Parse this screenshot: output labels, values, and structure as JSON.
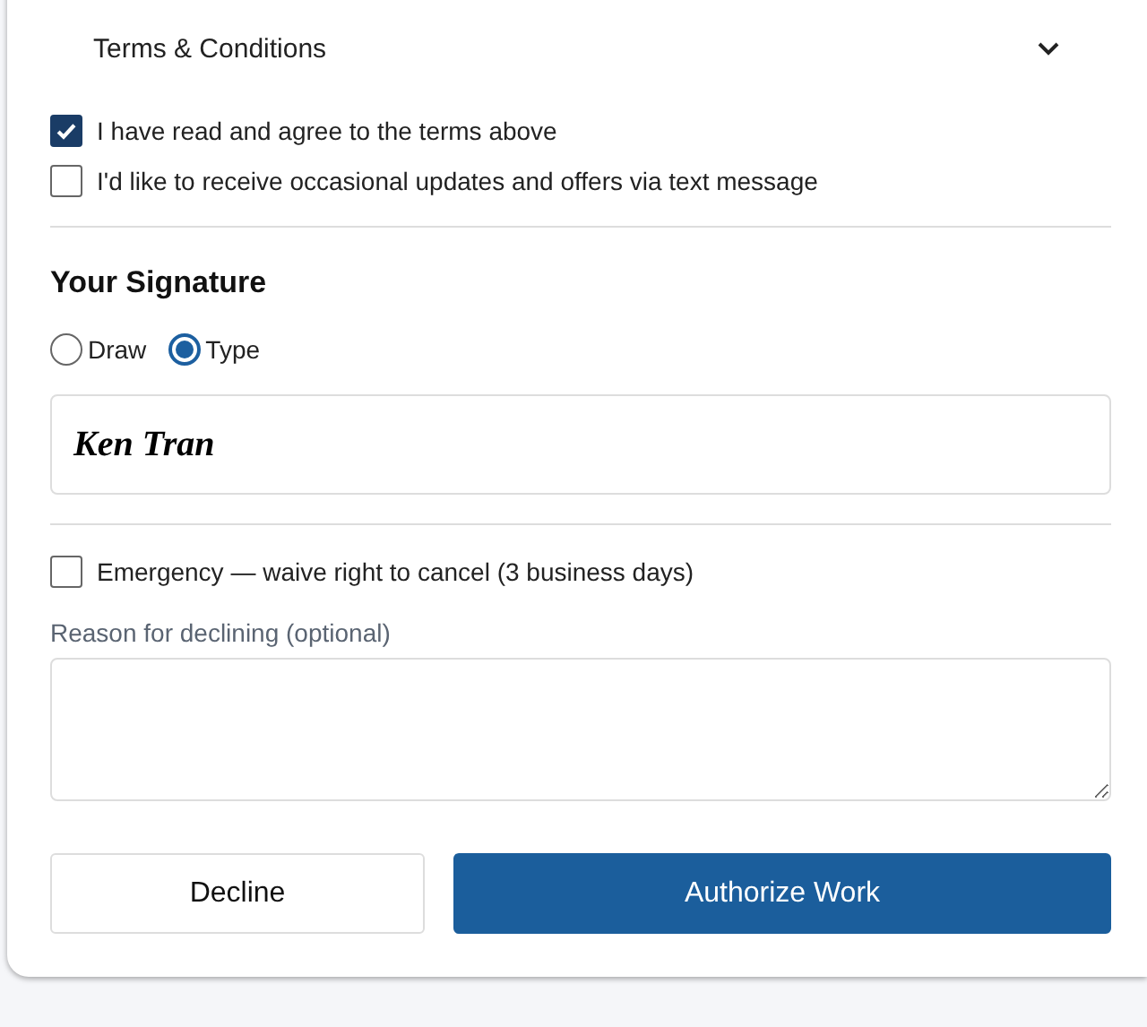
{
  "terms": {
    "title": "Terms & Conditions",
    "expanded": false
  },
  "agreements": [
    {
      "label": "I have read and agree to the terms above",
      "checked": true
    },
    {
      "label": "I'd like to receive occasional updates and offers via text message",
      "checked": false
    }
  ],
  "signature": {
    "heading": "Your Signature",
    "modes": [
      {
        "label": "Draw",
        "selected": false
      },
      {
        "label": "Type",
        "selected": true
      }
    ],
    "value": "Ken Tran"
  },
  "emergency": {
    "label": "Emergency — waive right to cancel (3 business days)",
    "checked": false
  },
  "decline_reason": {
    "label": "Reason for declining (optional)"
  },
  "buttons": [
    {
      "label": "Decline",
      "kind": "secondary"
    },
    {
      "label": "Authorize Work",
      "kind": "primary"
    }
  ]
}
